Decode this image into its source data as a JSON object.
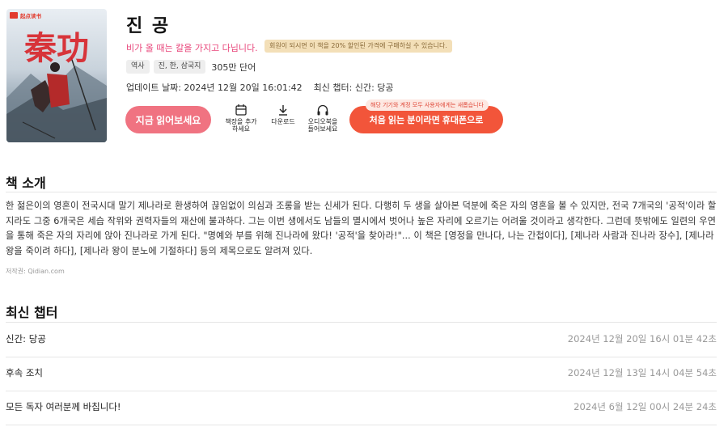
{
  "cover": {
    "publisher_logo": "起点读书",
    "title_art": "秦功"
  },
  "book": {
    "title": "진 공",
    "tagline": "비가 올 때는 칼을 가지고 다닙니다.",
    "promo_badge": "회원이 되시면 이 책을 20% 할인된 가격에 구매하실 수 있습니다.",
    "tags": [
      "역사",
      "진, 한, 삼국지"
    ],
    "word_count": "305만 단어",
    "updated_label": "업데이트 날짜: 2024년 12월 20일 16:01:42",
    "latest_chapter_label": "최신 챕터: 신간: 당공"
  },
  "actions": {
    "read_now": "지금 읽어보세요",
    "add_shelf": "책장을 추가하세요",
    "download": "다운로드",
    "audiobook": "오디오북을 들어보세요",
    "app_note": "해당 기기와 계정 모두 사용자에게는 새롭습니다",
    "first_read_app": "처음 읽는 분이라면 휴대폰으로"
  },
  "intro": {
    "heading": "책 소개",
    "text": "한 젊은이의 영혼이 전국시대 말기 제나라로 환생하여 끊임없이 의심과 조롱을 받는 신세가 된다. 다행히 두 생을 살아본 덕분에 죽은 자의 영혼을 볼 수 있지만, 전국 7개국의 '공적'이라 할지라도 그중 6개국은 세습 작위와 권력자들의 재산에 불과하다. 그는 이번 생에서도 남들의 멸시에서 벗어나 높은 자리에 오르기는 어려울 것이라고 생각한다. 그런데 뜻밖에도 일련의 우연을 통해 죽은 자의 자리에 앉아 진나라로 가게 된다. \"명예와 부를 위해 진나라에 왔다! '공적'을 찾아라!\"... 이 책은 [영정을 만나다, 나는 간첩이다], [제나라 사람과 진나라 장수], [제나라 왕을 죽이려 하다], [제나라 왕이 분노에 기절하다] 등의 제목으로도 알려져 있다.",
    "copyright": "저작권: Qidian.com"
  },
  "chapters": {
    "heading": "최신 챕터",
    "items": [
      {
        "name": "신간: 당공",
        "time": "2024년 12월 20일 16시 01분 42초"
      },
      {
        "name": "후속 조치",
        "time": "2024년 12월 13일 14시 04분 54초"
      },
      {
        "name": "모든 독자 여러분께 바칩니다!",
        "time": "2024년 6월 12일 00시 24분 24초"
      }
    ]
  },
  "colors": {
    "accent_pink": "#e8457a",
    "read_button": "#f07381",
    "app_button": "#f2553a",
    "promo_gold": "#f3dfb8"
  },
  "icons": [
    "bookshelf-icon",
    "download-icon",
    "headphones-icon"
  ]
}
